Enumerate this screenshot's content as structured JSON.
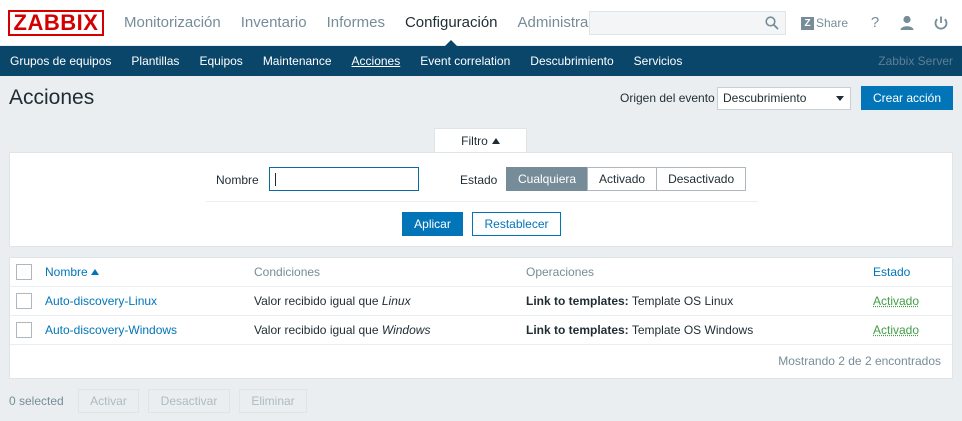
{
  "header": {
    "logo": "ZABBIX",
    "nav": [
      "Monitorización",
      "Inventario",
      "Informes",
      "Configuración",
      "Administración"
    ],
    "active_nav": "Configuración",
    "share_label": "Share",
    "help_label": "?"
  },
  "subnav": {
    "items": [
      "Grupos de equipos",
      "Plantillas",
      "Equipos",
      "Maintenance",
      "Acciones",
      "Event correlation",
      "Descubrimiento",
      "Servicios"
    ],
    "active": "Acciones",
    "server": "Zabbix Server"
  },
  "page": {
    "title": "Acciones",
    "origin_label": "Origen del evento",
    "origin_value": "Descubrimiento",
    "create_label": "Crear acción"
  },
  "filter": {
    "tab_label": "Filtro",
    "name_label": "Nombre",
    "name_value": "",
    "state_label": "Estado",
    "state_options": [
      "Cualquiera",
      "Activado",
      "Desactivado"
    ],
    "state_selected": "Cualquiera",
    "apply_label": "Aplicar",
    "reset_label": "Restablecer"
  },
  "table": {
    "headers": {
      "name": "Nombre",
      "conditions": "Condiciones",
      "operations": "Operaciones",
      "status": "Estado"
    },
    "rows": [
      {
        "name": "Auto-discovery-Linux",
        "condition_prefix": "Valor recibido igual que",
        "condition_value": "Linux",
        "operation_label": "Link to templates:",
        "operation_value": "Template OS Linux",
        "status": "Activado"
      },
      {
        "name": "Auto-discovery-Windows",
        "condition_prefix": "Valor recibido igual que",
        "condition_value": "Windows",
        "operation_label": "Link to templates:",
        "operation_value": "Template OS Windows",
        "status": "Activado"
      }
    ],
    "footer": "Mostrando 2 de 2 encontrados"
  },
  "bottom": {
    "selected": "0 selected",
    "actions": [
      "Activar",
      "Desactivar",
      "Eliminar"
    ]
  },
  "colors": {
    "brand": "#d40000",
    "nav_bar": "#0a466a",
    "primary": "#0275b8",
    "enabled": "#429e47"
  }
}
